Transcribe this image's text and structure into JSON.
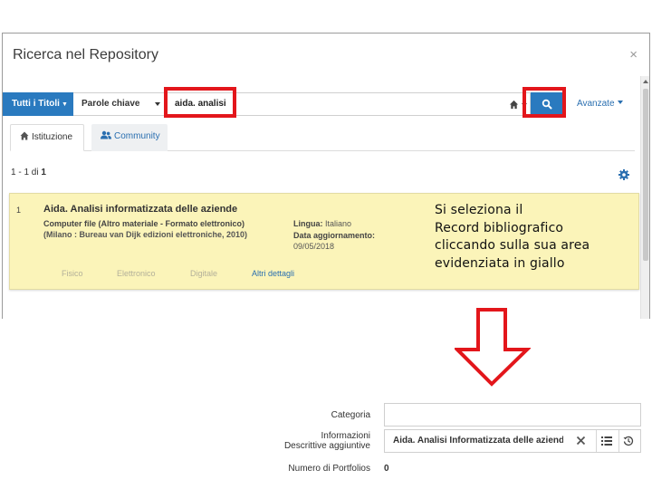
{
  "modal": {
    "title": "Ricerca nel Repository",
    "close_label": "×"
  },
  "search": {
    "scope_label": "Tutti i Titoli",
    "field_label": "Parole chiave",
    "query": "aida. analisi",
    "advanced_label": "Avanzate"
  },
  "tabs": [
    {
      "label": "Istituzione",
      "icon": "institution-icon",
      "active": true
    },
    {
      "label": "Community",
      "icon": "community-icon",
      "active": false
    }
  ],
  "results": {
    "range": "1 - 1",
    "of_label": "di",
    "total": "1",
    "items": [
      {
        "index": "1",
        "title": "Aida. Analisi informatizzata delle aziende",
        "type": "Computer file (Altro materiale - Formato elettronico)",
        "publisher": "(Milano : Bureau van Dijk edizioni elettroniche, 2010)",
        "language_label": "Lingua:",
        "language": "Italiano",
        "updated_label": "Data aggiornamento:",
        "updated": "09/05/2018",
        "links": [
          "Fisico",
          "Elettronico",
          "Digitale",
          "Altri dettagli"
        ]
      }
    ]
  },
  "annotation": {
    "line1": "Si seleziona il",
    "line2": "Record bibliografico",
    "line3": "cliccando sulla sua area",
    "line4": "evidenziata in giallo"
  },
  "form": {
    "category_label": "Categoria",
    "category_value": "",
    "info_label_line1": "Informazioni",
    "info_label_line2": "Descrittive aggiuntive",
    "info_value": "Aida. Analisi Informatizzata delle aziende",
    "portfolio_label": "Numero di Portfolios",
    "portfolio_value": "0"
  },
  "colors": {
    "primary_blue": "#2a7abf",
    "highlight_red": "#e3161b",
    "result_yellow": "#fbf4b9"
  }
}
